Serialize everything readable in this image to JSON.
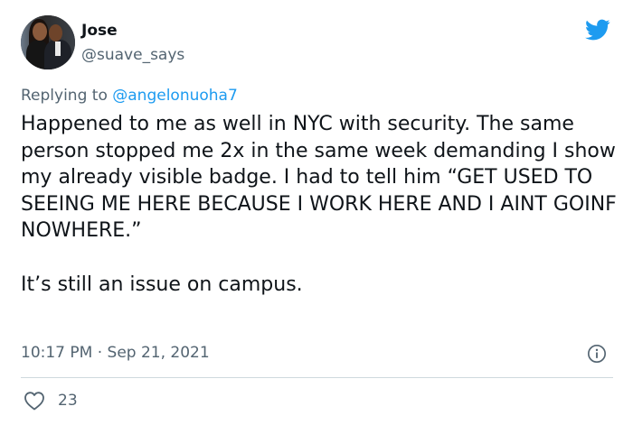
{
  "author": {
    "name": "Jose",
    "handle": "@suave_says"
  },
  "reply": {
    "prefix": "Replying to ",
    "to": "@angelonuoha7"
  },
  "tweet": {
    "paragraphs": [
      "Happened to me as well in NYC with security. The same person stopped me 2x in the same week demanding I show my already visible badge. I had to tell him “GET USED TO SEEING ME HERE BECAUSE I WORK HERE AND I AINT GOINF NOWHERE.”",
      "It’s still an issue on campus."
    ]
  },
  "meta": {
    "timestamp": "10:17 PM · Sep 21, 2021"
  },
  "engagement": {
    "likes": "23"
  },
  "icons": {
    "brand": "twitter-bird-icon",
    "info": "info-icon",
    "like": "heart-icon"
  },
  "colors": {
    "brand_blue": "#1d9bf0",
    "text_primary": "#0f1419",
    "text_secondary": "#536471",
    "divider": "#cfd9de"
  }
}
